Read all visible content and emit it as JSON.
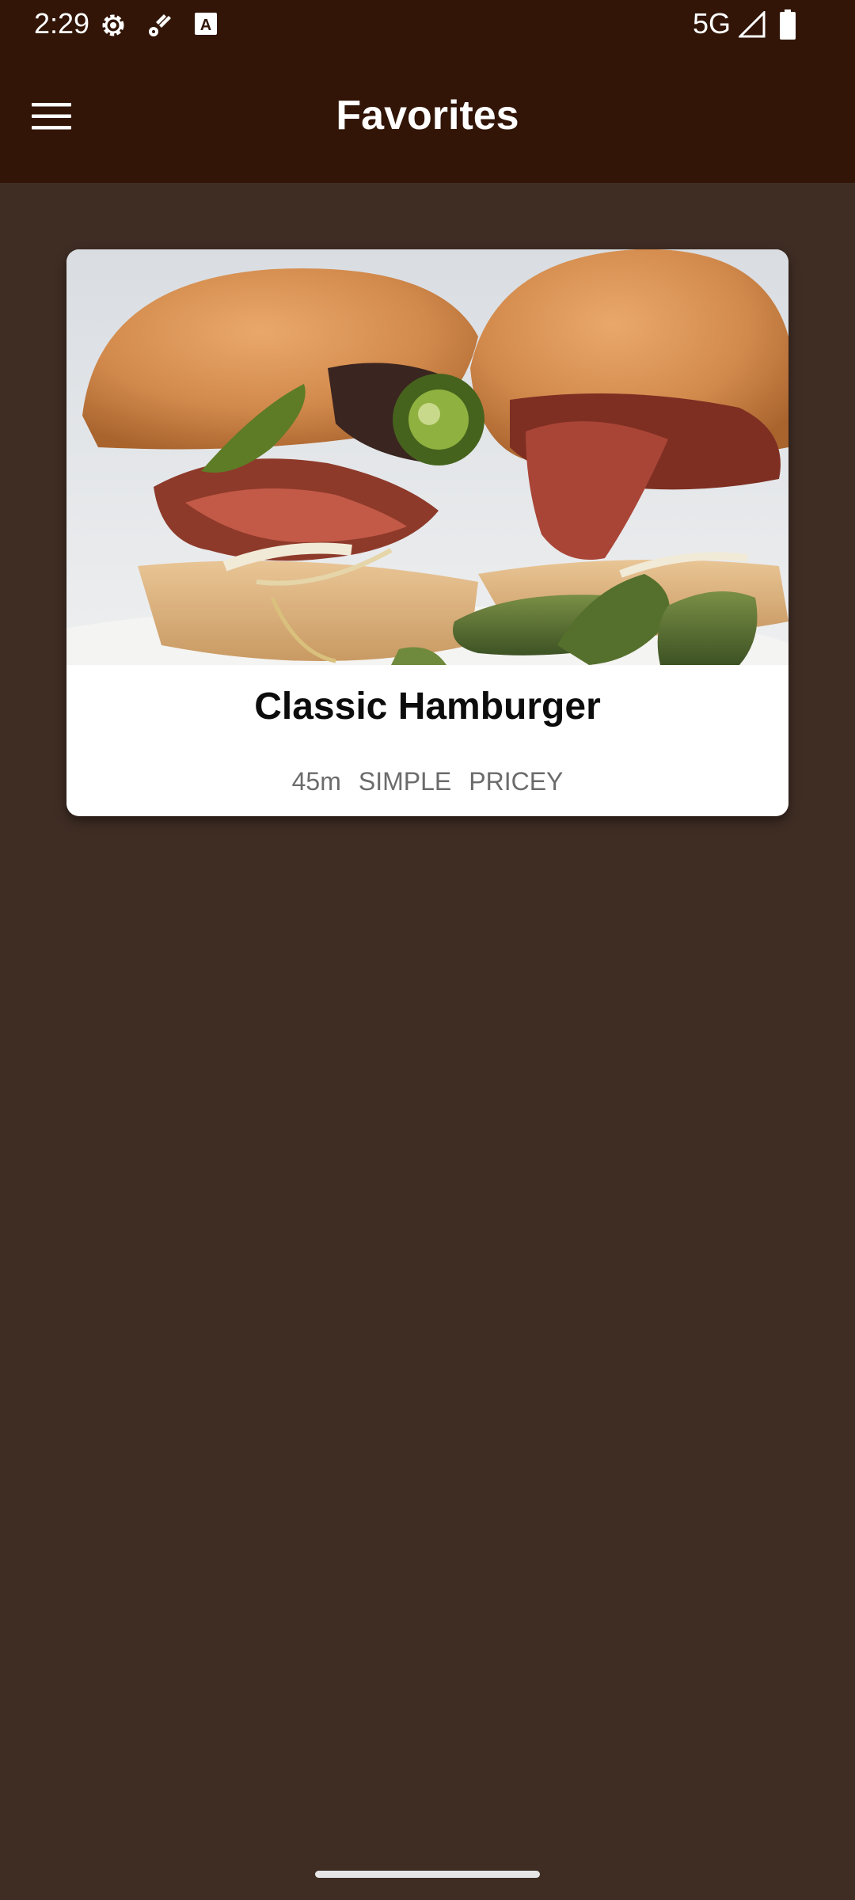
{
  "status_bar": {
    "time": "2:29",
    "network": "5G",
    "icons": [
      "settings-icon",
      "fan-icon",
      "text-a-icon",
      "signal-icon",
      "battery-icon"
    ]
  },
  "app_bar": {
    "title": "Favorites",
    "menu_icon": "hamburger-menu-icon"
  },
  "favorites": [
    {
      "title": "Classic Hamburger",
      "duration": "45m",
      "complexity": "SIMPLE",
      "affordability": "PRICEY",
      "image": "hamburger-photo"
    }
  ],
  "colors": {
    "app_bar": "#321507",
    "background": "#3f2d24",
    "card": "#ffffff",
    "title_text": "#0d0d0d",
    "meta_text": "#6b6b6b"
  }
}
